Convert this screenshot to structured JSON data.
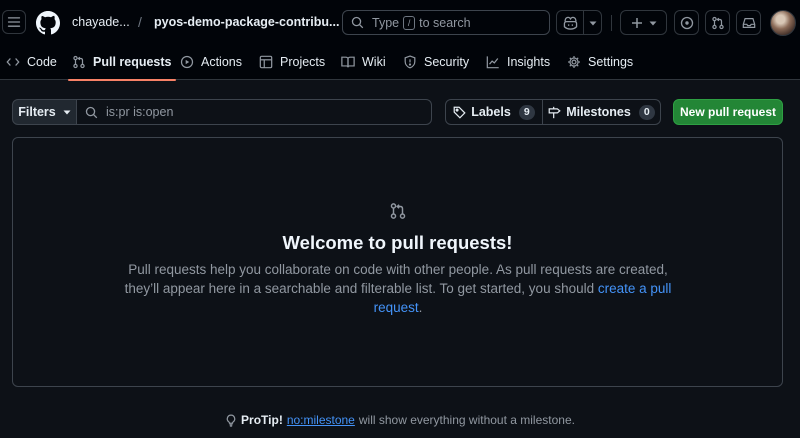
{
  "header": {
    "owner": "chayade...",
    "separator": "/",
    "repo": "pyos-demo-package-contribu...",
    "search_prefix": "Type",
    "search_key": "/",
    "search_suffix": "to search"
  },
  "nav": {
    "code": "Code",
    "pull_requests": "Pull requests",
    "actions": "Actions",
    "projects": "Projects",
    "wiki": "Wiki",
    "security": "Security",
    "insights": "Insights",
    "settings": "Settings"
  },
  "toolbar": {
    "filters_label": "Filters",
    "filter_value": "is:pr is:open",
    "labels_label": "Labels",
    "labels_count": "9",
    "milestones_label": "Milestones",
    "milestones_count": "0",
    "new_pr_label": "New pull request"
  },
  "blankslate": {
    "title": "Welcome to pull requests!",
    "text": "Pull requests help you collaborate on code with other people. As pull requests are created, they’ll appear here in a searchable and filterable list. To get started, you should",
    "link": "create a pull request",
    "period": "."
  },
  "protip": {
    "label": "ProTip!",
    "link": "no:milestone",
    "text": "will show everything without a milestone."
  },
  "colors": {
    "background": "#0d1117",
    "accent_underline": "#f78166",
    "primary_button": "#238636",
    "link": "#4493f8"
  }
}
